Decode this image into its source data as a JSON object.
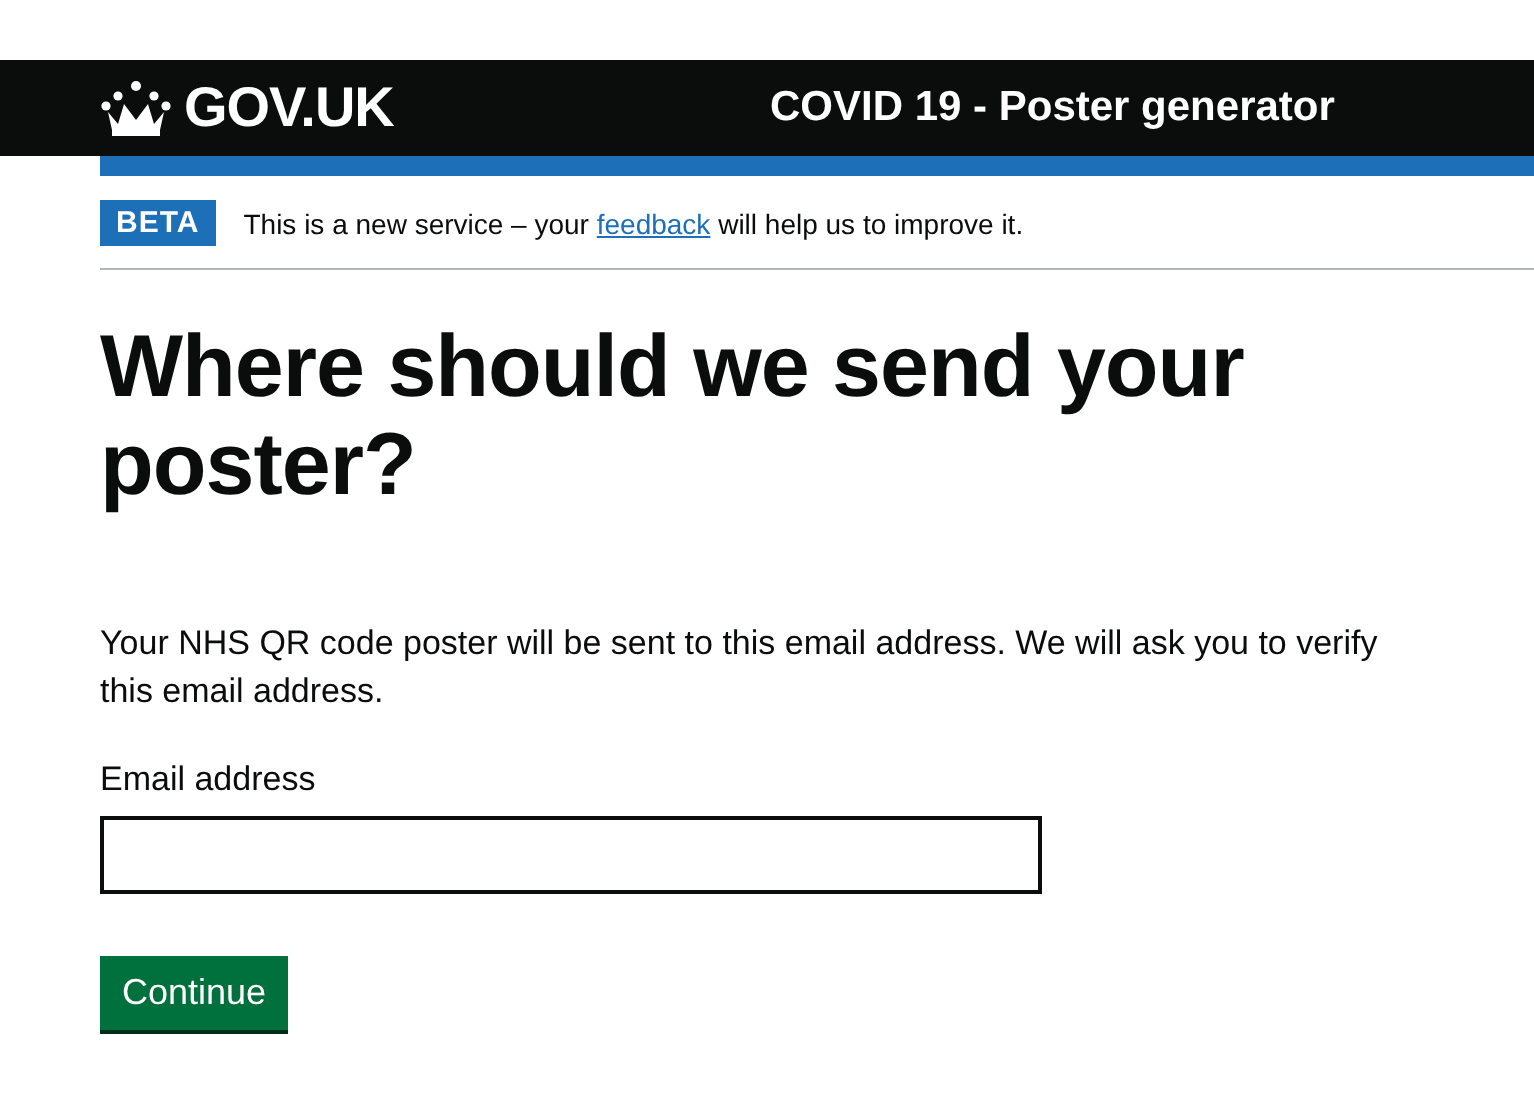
{
  "header": {
    "logo": "GOV.UK",
    "service_name": "COVID 19 - Poster generator"
  },
  "phase_banner": {
    "tag": "BETA",
    "text_before": "This is a new service – your ",
    "link": "feedback",
    "text_after": " will help us to improve it."
  },
  "heading": "Where should we send your poster?",
  "body": "Your NHS QR code poster will be sent to this email address. We will ask you to verify this email address.",
  "email_field": {
    "label": "Email address"
  },
  "button": "Continue"
}
